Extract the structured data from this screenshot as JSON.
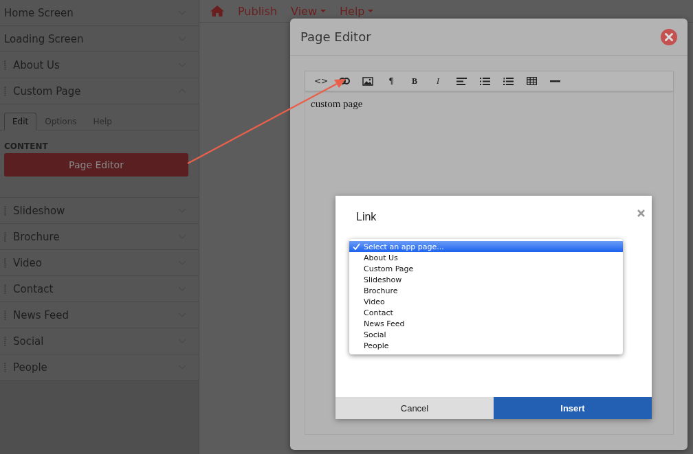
{
  "sidebar": {
    "items": [
      {
        "label": "Home Screen",
        "draggable": false,
        "expanded": false
      },
      {
        "label": "Loading Screen",
        "draggable": false,
        "expanded": false
      },
      {
        "label": "About Us",
        "draggable": true,
        "expanded": false
      },
      {
        "label": "Custom Page",
        "draggable": true,
        "expanded": true,
        "panel": {
          "tabs": [
            {
              "label": "Edit",
              "selected": true
            },
            {
              "label": "Options",
              "selected": false
            },
            {
              "label": "Help",
              "selected": false
            }
          ],
          "section_label": "CONTENT",
          "button": "Page Editor"
        }
      },
      {
        "label": "Slideshow",
        "draggable": true,
        "expanded": false
      },
      {
        "label": "Brochure",
        "draggable": true,
        "expanded": false
      },
      {
        "label": "Video",
        "draggable": true,
        "expanded": false
      },
      {
        "label": "Contact",
        "draggable": true,
        "expanded": false
      },
      {
        "label": "News Feed",
        "draggable": true,
        "expanded": false
      },
      {
        "label": "Social",
        "draggable": true,
        "expanded": false
      },
      {
        "label": "People",
        "draggable": true,
        "expanded": false
      }
    ]
  },
  "topbar": {
    "items": [
      {
        "kind": "home"
      },
      {
        "kind": "link",
        "label": "Publish"
      },
      {
        "kind": "menu",
        "label": "View"
      },
      {
        "kind": "menu",
        "label": "Help"
      }
    ]
  },
  "editor": {
    "title": "Page Editor",
    "tools": [
      {
        "kind": "glyph",
        "label": "<>"
      },
      {
        "kind": "link"
      },
      {
        "kind": "image"
      },
      {
        "kind": "glyph",
        "label": "¶"
      },
      {
        "kind": "bold",
        "label": "B"
      },
      {
        "kind": "italic",
        "label": "I"
      },
      {
        "kind": "align"
      },
      {
        "kind": "bullets"
      },
      {
        "kind": "numbers"
      },
      {
        "kind": "table"
      },
      {
        "kind": "rule"
      }
    ],
    "content": "custom page"
  },
  "link_dialog": {
    "title": "Link",
    "options": [
      {
        "label": "Select an app page...",
        "selected": true
      },
      {
        "label": "About Us",
        "selected": false
      },
      {
        "label": "Custom Page",
        "selected": false
      },
      {
        "label": "Slideshow",
        "selected": false
      },
      {
        "label": "Brochure",
        "selected": false
      },
      {
        "label": "Video",
        "selected": false
      },
      {
        "label": "Contact",
        "selected": false
      },
      {
        "label": "News Feed",
        "selected": false
      },
      {
        "label": "Social",
        "selected": false
      },
      {
        "label": "People",
        "selected": false
      }
    ],
    "buttons": [
      {
        "kind": "cancel",
        "label": "Cancel"
      },
      {
        "kind": "primary",
        "label": "Insert"
      }
    ]
  }
}
